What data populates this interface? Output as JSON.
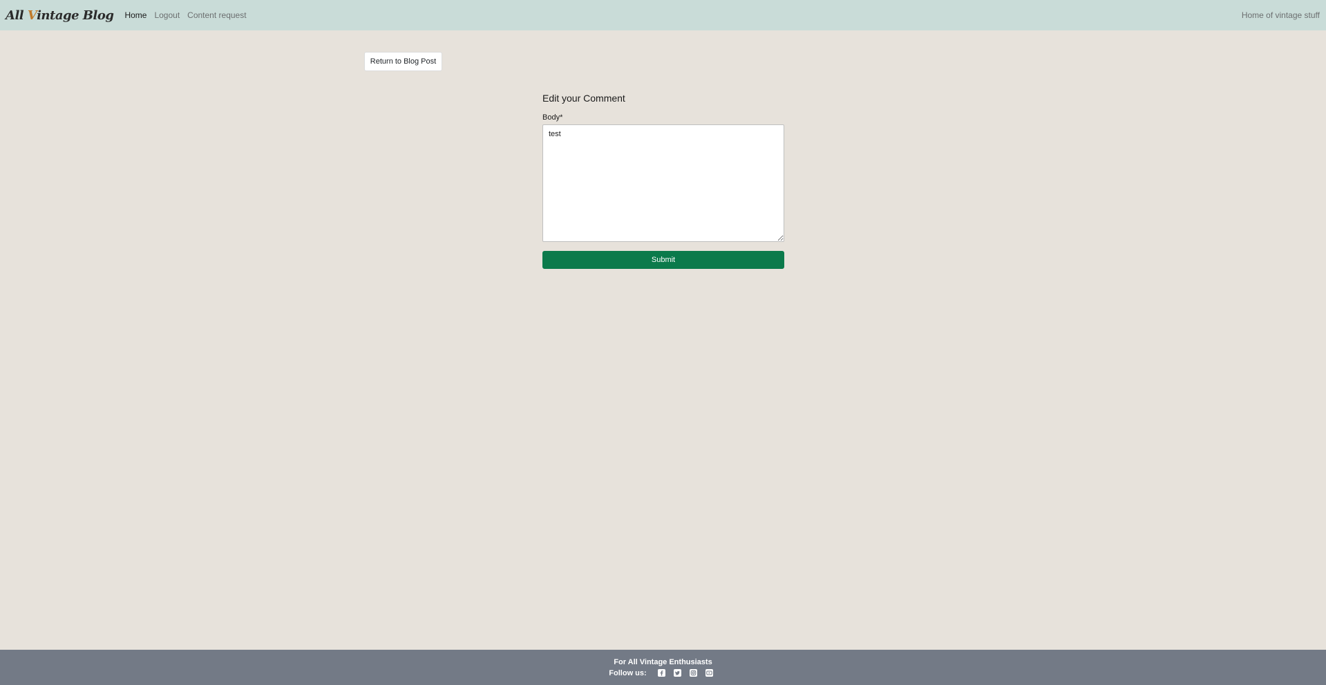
{
  "navbar": {
    "brand_part1": "All ",
    "brand_accent": "V",
    "brand_part2": "intage Blog",
    "links": [
      {
        "label": "Home"
      },
      {
        "label": "Logout"
      },
      {
        "label": "Content request"
      }
    ],
    "right_text": "Home of vintage stuff"
  },
  "main": {
    "return_button": "Return to Blog Post",
    "form_title": "Edit your Comment",
    "body_label": "Body*",
    "body_value": "test",
    "submit_label": "Submit"
  },
  "footer": {
    "tagline": "For All Vintage Enthusiasts",
    "follow_label": "Follow us:",
    "social_icons": [
      "facebook-icon",
      "twitter-icon",
      "instagram-icon",
      "youtube-icon"
    ]
  },
  "colors": {
    "navbar_bg": "#c9dcd8",
    "page_bg": "#e7e2db",
    "submit_bg": "#0b7a4b",
    "footer_bg": "#737a86",
    "brand_accent": "#c07a2a"
  }
}
